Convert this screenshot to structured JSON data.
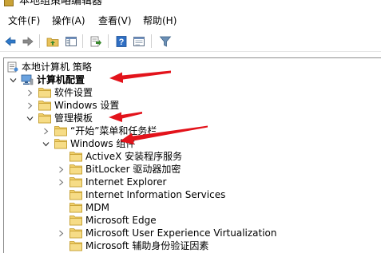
{
  "window": {
    "title": "本地组策略编辑器",
    "icon": "policy-editor-icon"
  },
  "menu": [
    {
      "label": "文件(F)"
    },
    {
      "label": "操作(A)"
    },
    {
      "label": "查看(V)"
    },
    {
      "label": "帮助(H)"
    }
  ],
  "toolbar": {
    "buttons": [
      "back-icon",
      "forward-icon",
      "up-folder-icon",
      "show-hide-tree-icon",
      "export-list-icon",
      "help-icon",
      "properties-icon",
      "filter-icon"
    ]
  },
  "tree": {
    "root": "本地计算机 策略",
    "computer_config": "计算机配置",
    "software_settings": "软件设置",
    "windows_settings": "Windows 设置",
    "admin_templates": "管理模板",
    "start_menu": "“开始”菜单和任务栏",
    "windows_components": "Windows 组件",
    "components": [
      "ActiveX 安装程序服务",
      "BitLocker 驱动器加密",
      "Internet Explorer",
      "Internet Information Services",
      "MDM",
      "Microsoft Edge",
      "Microsoft User Experience Virtualization",
      "Microsoft 辅助身份验证因素"
    ]
  },
  "colors": {
    "annotation_arrow": "#e3131b",
    "folder": "#e8c25a",
    "tree_border": "#8e8e8e"
  }
}
